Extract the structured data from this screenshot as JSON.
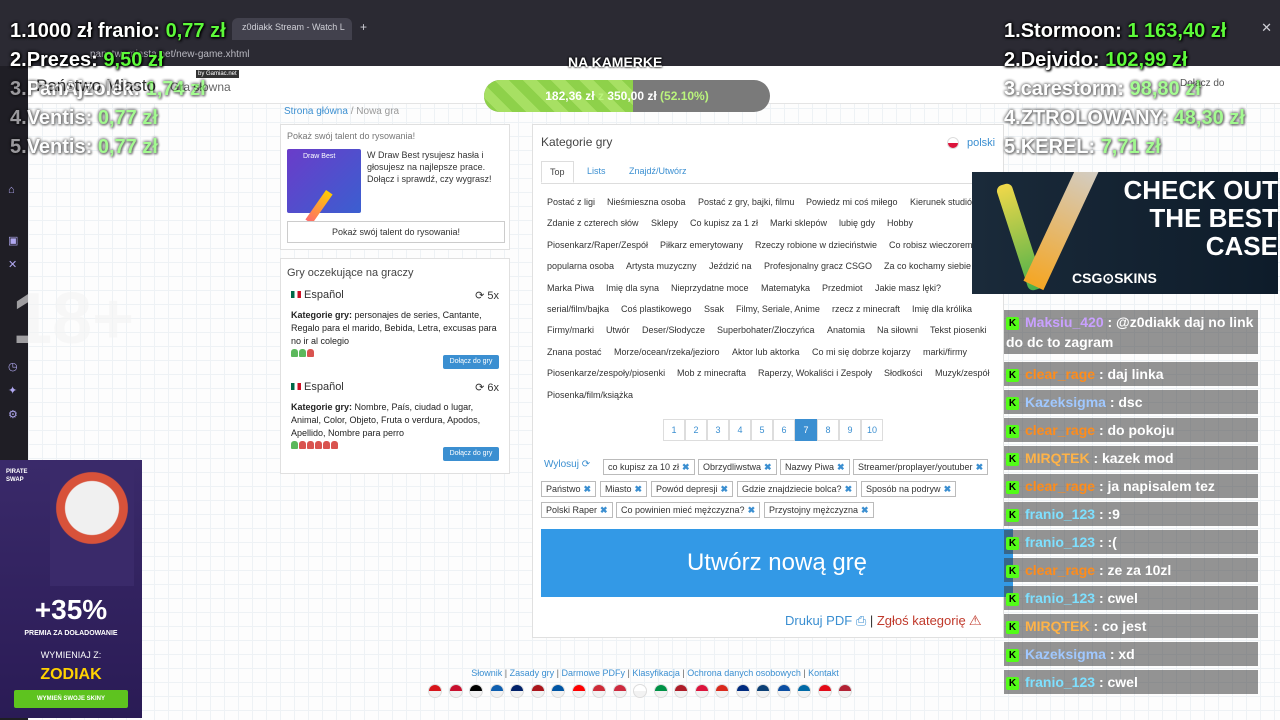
{
  "browser": {
    "tab_title": "z0diakk Stream - Watch L",
    "url": "panstwamiasta.net/new-game.xhtml"
  },
  "site": {
    "logo": "Państwo Miasto",
    "logo_badge": "by Gamiac.net",
    "subtitle": "Gra słowna",
    "top_lang": "Dołącz do"
  },
  "breadcrumb": {
    "home": "Strona główna",
    "sep": " / ",
    "current": "Nowa gra"
  },
  "promo": {
    "header": "Pokaż swój talent do rysowania!",
    "img_label": "Draw Best",
    "text": "W Draw Best rysujesz hasła i głosujesz na najlepsze prace. Dołącz i sprawdź, czy wygrasz!",
    "button": "Pokaż swój talent do rysowania!"
  },
  "pending": {
    "title": "Gry oczekujące na graczy",
    "categories_label": "Kategorie gry:",
    "join_label": "Dołącz do gry",
    "games": [
      {
        "lang": "Español",
        "time": "5x",
        "categories": "personajes de series, Cantante, Regalo para el marido, Bebida, Letra, excusas para no ir al colegio",
        "players": [
          "g",
          "g",
          "r"
        ]
      },
      {
        "lang": "Español",
        "time": "6x",
        "categories": "Nombre, País, ciudad o lugar, Animal, Color, Objeto, Fruta o verdura, Apodos, Apellido, Nombre para perro",
        "players": [
          "g",
          "r",
          "r",
          "r",
          "r",
          "r"
        ]
      }
    ]
  },
  "main": {
    "title": "Kategorie gry",
    "language": "polski",
    "tabs": [
      "Top",
      "Lists",
      "Znajdź/Utwórz"
    ],
    "category_rows": [
      [
        "Postać z ligi",
        "Nieśmieszna osoba",
        "Postać z gry, bajki, filmu",
        "Powiedz mi coś miłego",
        "Kierunek studiów"
      ],
      [
        "Zdanie z czterech słów",
        "Sklepy",
        "Co kupisz za 1 zł",
        "Marki sklepów",
        "lubię gdy",
        "Hobby"
      ],
      [
        "Piosenkarz/Raper/Zespół",
        "Piłkarz emerytowany",
        "Rzeczy robione w dzieciństwie",
        "Co robisz wieczorem"
      ],
      [
        "popularna osoba",
        "Artysta muzyczny",
        "Jeździć na",
        "Profesjonalny gracz CSGO",
        "Za co kochamy siebie"
      ],
      [
        "Marka Piwa",
        "Imię dla syna",
        "Nieprzydatne moce",
        "Matematyka",
        "Przedmiot",
        "Jakie masz lęki?"
      ],
      [
        "serial/film/bajka",
        "Coś plastikowego",
        "Ssak",
        "Filmy, Seriale, Anime",
        "rzecz z minecraft",
        "Imię dla królika"
      ],
      [
        "Firmy/marki",
        "Utwór",
        "Deser/Słodycze",
        "Superbohater/Złoczyńca",
        "Anatomia",
        "Na siłowni",
        "Tekst piosenki"
      ],
      [
        "Znana postać",
        "Morze/ocean/rzeka/jezioro",
        "Aktor lub aktorka",
        "Co mi się dobrze kojarzy",
        "marki/firmy"
      ],
      [
        "Piosenkarze/zespoły/piosenki",
        "Mob z minecrafta",
        "Raperzy, Wokaliści i Zespoły",
        "Słodkości",
        "Muzyk/zespół"
      ],
      [
        "Piosenka/film/książka"
      ]
    ],
    "pages": [
      "1",
      "2",
      "3",
      "4",
      "5",
      "6",
      "7",
      "8",
      "9",
      "10"
    ],
    "active_page": 6,
    "random_label": "Wylosuj",
    "selected_chips": [
      [
        "co kupisz za 10 zł",
        "Obrzydliwstwa",
        "Nazwy Piwa",
        "Streamer/proplayer/youtuber"
      ],
      [
        "Państwo",
        "Miasto",
        "Powód depresji",
        "Gdzie znajdziecie bolca?",
        "Sposób na podryw"
      ],
      [
        "Polski Raper",
        "Co powinien mieć mężczyzna?",
        "Przystojny mężczyzna"
      ]
    ],
    "chip_remove": "✖",
    "create_button": "Utwórz nową grę",
    "print_pdf": "Drukuj PDF",
    "report": "Zgłoś kategorię",
    "pipe": " | "
  },
  "footer": {
    "links": [
      "Słownik",
      "Zasady gry",
      "Darmowe PDFy",
      "Klasyfikacja",
      "Ochrona danych osobowych",
      "Kontakt"
    ],
    "sep": " | ",
    "flag_colors": [
      "#d7141a",
      "#c8102e",
      "#000000",
      "#0d5eaf",
      "#012169",
      "#aa151b",
      "#0055a4",
      "#ff0000",
      "#ce2b37",
      "#cd2a3e",
      "#ffffff",
      "#009246",
      "#ae1c28",
      "#dc143c",
      "#da291c",
      "#002b7f",
      "#0c4076",
      "#0b4ea2",
      "#006aa7",
      "#e30a17",
      "#b22234"
    ]
  },
  "stream": {
    "goal_label": "NA KAMERKE",
    "goal_current": "182,36 zł",
    "goal_z": "z",
    "goal_target": "350,00 zł",
    "goal_percent": "(52.10%)",
    "goal_fraction": 0.521,
    "top_left": [
      {
        "rank": "1.",
        "name": "1000 zł franio:",
        "amount": "0,77 zł"
      },
      {
        "rank": "2.",
        "name": "Prezes:",
        "amount": "9,50 zł"
      },
      {
        "rank": "3.",
        "name": "PanAjzolek:",
        "amount": "1,74 zł"
      },
      {
        "rank": "4.",
        "name": "Ventis:",
        "amount": "0,77 zł"
      },
      {
        "rank": "5.",
        "name": "Ventis:",
        "amount": "0,77 zł"
      }
    ],
    "top_right": [
      {
        "rank": "1.",
        "name": "Stormoon:",
        "amount": "1 163,40 zł"
      },
      {
        "rank": "2.",
        "name": "Dejvido:",
        "amount": "102,99 zł"
      },
      {
        "rank": "3.",
        "name": "carestorm:",
        "amount": "98,80 zł"
      },
      {
        "rank": "4.",
        "name": "ZTROLOWANY:",
        "amount": "48,30 zł"
      },
      {
        "rank": "5.",
        "name": "KEREL:",
        "amount": "7,71 zł"
      }
    ],
    "age": "18+"
  },
  "ad_left": {
    "brand": "PIRATE SWAP",
    "percent": "+35%",
    "subtitle": "PREMIA ZA DOŁADOWANIE",
    "code_label": "WYMIENIAJ Z:",
    "code": "ZODIAK",
    "button": "WYMIEŃ SWOJE SKINY"
  },
  "ad_right": {
    "headline": "CHECK OUT THE BEST CASE",
    "brand": "CSG⊙SKINS"
  },
  "chat": [
    {
      "user": "Maksiu_420",
      "color": "#c9a0ff",
      "msg": ": @z0diakk daj no link do dc to zagram"
    },
    {
      "user": "clear_rage",
      "color": "#ff8c1a",
      "msg": ": daj linka"
    },
    {
      "user": "Kazeksigma",
      "color": "#a0c8ff",
      "msg": ": dsc"
    },
    {
      "user": "clear_rage",
      "color": "#ff8c1a",
      "msg": ": do pokoju"
    },
    {
      "user": "MIRQTEK",
      "color": "#ffb347",
      "msg": ": kazek mod"
    },
    {
      "user": "clear_rage",
      "color": "#ff8c1a",
      "msg": ": ja napisalem tez"
    },
    {
      "user": "franio_123",
      "color": "#7ee0ff",
      "msg": ": :9"
    },
    {
      "user": "franio_123",
      "color": "#7ee0ff",
      "msg": ": :("
    },
    {
      "user": "clear_rage",
      "color": "#ff8c1a",
      "msg": ": ze za 10zl"
    },
    {
      "user": "franio_123",
      "color": "#7ee0ff",
      "msg": ": cwel"
    },
    {
      "user": "MIRQTEK",
      "color": "#ffb347",
      "msg": ": co jest"
    },
    {
      "user": "Kazeksigma",
      "color": "#a0c8ff",
      "msg": ": xd"
    },
    {
      "user": "franio_123",
      "color": "#7ee0ff",
      "msg": ": cwel"
    }
  ]
}
